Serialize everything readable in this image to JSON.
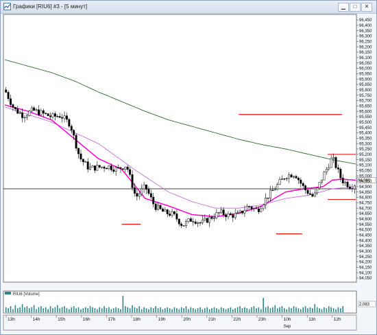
{
  "window": {
    "title": "Графики [RIU6] #3 - [5 минут]",
    "buttons": [
      "minimize",
      "maximize",
      "close"
    ]
  },
  "colors": {
    "price": "#000000",
    "ma_fast": "#ff00cc",
    "ma_mid": "#c060e0",
    "ma_slow": "#2e6b2e",
    "levels": "#e00000",
    "volume": "#2a8a8a"
  },
  "chart_data": {
    "type": "candlestick",
    "y_ticks": [
      "96,450",
      "96,400",
      "96,350",
      "96,300",
      "96,250",
      "96,200",
      "96,150",
      "96,100",
      "96,050",
      "96,000",
      "95,950",
      "95,900",
      "95,850",
      "95,800",
      "95,750",
      "95,700",
      "95,650",
      "95,600",
      "95,550",
      "95,500",
      "95,450",
      "95,400",
      "95,350",
      "95,300",
      "95,250",
      "95,200",
      "95,150",
      "95,100",
      "95,050",
      "95,000",
      "94,950",
      "94,900",
      "94,850",
      "94,800",
      "94,750",
      "94,700",
      "94,650",
      "94,600",
      "94,550",
      "94,500",
      "94,450",
      "94,400",
      "94,350",
      "94,300",
      "94,250",
      "94,200",
      "94,150",
      "94,100",
      "94,050"
    ],
    "ylim": [
      94050,
      96450
    ],
    "x_ticks": [
      "13h",
      "14h",
      "15h",
      "16h",
      "17h",
      "18h",
      "19h",
      "20h",
      "21h",
      "22h",
      "23h",
      "10h",
      "11h",
      "12h"
    ],
    "x_sublabel": "Sep",
    "last_price": "94,960",
    "horizontal_line": 94880,
    "resistance": 95200,
    "support": 94780,
    "level_marks": [
      95570,
      94550,
      94460
    ],
    "price_path": [
      [
        0,
        95800
      ],
      [
        4,
        95620
      ],
      [
        8,
        95560
      ],
      [
        12,
        95610
      ],
      [
        16,
        95580
      ],
      [
        20,
        95550
      ],
      [
        24,
        95560
      ],
      [
        28,
        95480
      ],
      [
        32,
        95170
      ],
      [
        36,
        95070
      ],
      [
        40,
        95080
      ],
      [
        44,
        95090
      ],
      [
        48,
        95060
      ],
      [
        52,
        95100
      ],
      [
        56,
        94800
      ],
      [
        60,
        94900
      ],
      [
        64,
        94720
      ],
      [
        68,
        94660
      ],
      [
        72,
        94640
      ],
      [
        76,
        94540
      ],
      [
        80,
        94600
      ],
      [
        84,
        94560
      ],
      [
        88,
        94610
      ],
      [
        92,
        94660
      ],
      [
        96,
        94630
      ],
      [
        100,
        94640
      ],
      [
        104,
        94720
      ],
      [
        108,
        94680
      ],
      [
        112,
        94800
      ],
      [
        116,
        94900
      ],
      [
        120,
        95000
      ],
      [
        124,
        95020
      ],
      [
        128,
        94880
      ],
      [
        132,
        94800
      ],
      [
        136,
        95000
      ],
      [
        140,
        95170
      ],
      [
        144,
        94960
      ],
      [
        148,
        94900
      ],
      [
        150,
        94930
      ]
    ],
    "ma_fast": [
      [
        0,
        95660
      ],
      [
        10,
        95600
      ],
      [
        20,
        95520
      ],
      [
        30,
        95340
      ],
      [
        40,
        95160
      ],
      [
        50,
        95060
      ],
      [
        56,
        94900
      ],
      [
        60,
        94790
      ],
      [
        70,
        94720
      ],
      [
        80,
        94640
      ],
      [
        90,
        94620
      ],
      [
        100,
        94650
      ],
      [
        110,
        94720
      ],
      [
        116,
        94800
      ],
      [
        120,
        94850
      ],
      [
        128,
        94880
      ],
      [
        136,
        94900
      ],
      [
        140,
        94960
      ],
      [
        144,
        94970
      ],
      [
        150,
        94960
      ]
    ],
    "ma_mid": [
      [
        0,
        95640
      ],
      [
        20,
        95500
      ],
      [
        40,
        95300
      ],
      [
        56,
        95050
      ],
      [
        70,
        94850
      ],
      [
        80,
        94760
      ],
      [
        90,
        94700
      ],
      [
        100,
        94700
      ],
      [
        110,
        94730
      ],
      [
        120,
        94790
      ],
      [
        130,
        94820
      ],
      [
        140,
        94880
      ],
      [
        150,
        94900
      ]
    ],
    "ma_slow": [
      [
        0,
        96080
      ],
      [
        10,
        96020
      ],
      [
        20,
        95960
      ],
      [
        30,
        95880
      ],
      [
        40,
        95780
      ],
      [
        50,
        95690
      ],
      [
        60,
        95600
      ],
      [
        70,
        95520
      ],
      [
        80,
        95460
      ],
      [
        90,
        95400
      ],
      [
        100,
        95340
      ],
      [
        110,
        95290
      ],
      [
        120,
        95250
      ],
      [
        130,
        95200
      ],
      [
        140,
        95150
      ],
      [
        150,
        95110
      ]
    ],
    "volume_label": "RIU6 [Volume]",
    "volume_value": "2,083",
    "volume_bars": [
      5,
      4,
      6,
      3,
      7,
      4,
      5,
      8,
      5,
      6,
      4,
      5,
      7,
      3,
      5,
      6,
      4,
      5,
      3,
      6,
      4,
      5,
      7,
      4,
      5,
      6,
      4,
      3,
      5,
      6,
      4,
      5,
      3,
      4,
      5,
      4,
      6,
      5,
      4,
      3,
      5,
      4,
      6,
      4,
      5,
      3,
      4,
      5,
      4,
      3,
      16,
      6,
      5,
      4,
      7,
      5,
      4,
      6,
      3,
      5,
      4,
      3,
      5,
      4,
      6,
      4,
      5,
      3,
      4,
      5,
      4,
      3,
      5,
      4,
      3,
      5,
      4,
      6,
      3,
      5,
      4,
      3,
      4,
      5,
      3,
      4,
      5,
      3,
      4,
      5,
      4,
      3,
      5,
      4,
      3,
      4,
      5,
      3,
      4,
      5,
      6,
      4,
      5,
      4,
      3,
      5,
      6,
      4,
      5,
      3,
      14,
      5,
      6,
      4,
      5,
      7,
      4,
      5,
      6,
      4,
      3,
      5,
      4,
      6,
      5,
      4,
      3,
      5,
      6,
      4,
      5,
      4,
      8,
      5,
      4,
      3,
      5,
      4,
      6,
      5,
      4,
      3,
      5,
      4,
      6
    ]
  }
}
